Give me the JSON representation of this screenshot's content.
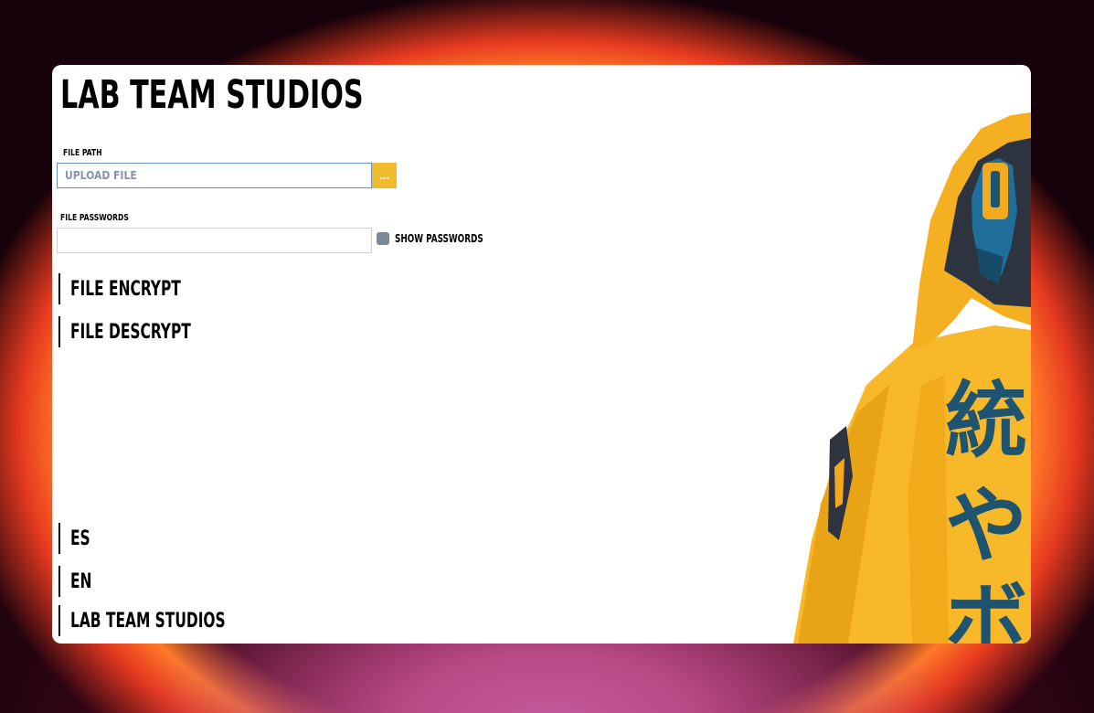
{
  "app": {
    "title": "LAB TEAM STUDIOS"
  },
  "file_path": {
    "label": "FILE PATH",
    "placeholder": "UPLOAD FILE",
    "value": "",
    "browse_label": "..."
  },
  "passwords": {
    "label": "FILE PASSWORDS",
    "value": "",
    "show_label": "SHOW PASSWORDS",
    "show_checked": false
  },
  "menu": {
    "encrypt": "FILE ENCRYPT",
    "decrypt": "FILE DESCRYPT"
  },
  "footer": {
    "lang_es": "ES",
    "lang_en": "EN",
    "studio": "LAB TEAM STUDIOS"
  },
  "colors": {
    "accent": "#f2bb2e",
    "checkbox": "#7d8896",
    "hoodie": "#f7b92a",
    "glyph": "#1f5470"
  },
  "artwork": {
    "glyphs": [
      "統",
      "や",
      "ボ"
    ]
  }
}
